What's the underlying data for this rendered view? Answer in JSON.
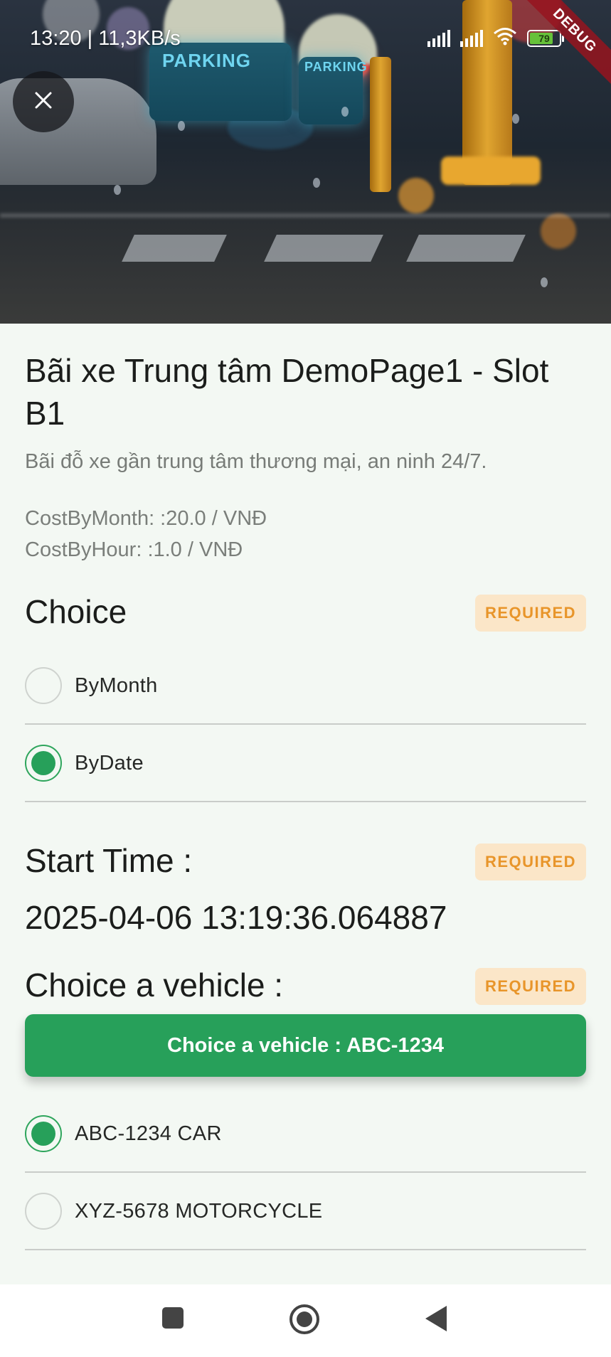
{
  "status_bar": {
    "time": "13:20 | 11,3KB/s",
    "battery_level": "79",
    "battery_fraction": 0.79
  },
  "debug_banner": "DEBUG",
  "hero": {
    "sign_texts": [
      "PARKING",
      "PARKING"
    ],
    "close_icon": "close-icon"
  },
  "lot": {
    "title": "Bãi xe Trung tâm DemoPage1    - Slot B1",
    "description": "Bãi đỗ xe gần trung tâm thương mại, an ninh 24/7.",
    "cost_by_month": "CostByMonth: :20.0 / VNĐ",
    "cost_by_hour": "CostByHour: :1.0 / VNĐ"
  },
  "choice": {
    "title": "Choice",
    "badge": "REQUIRED",
    "options": [
      {
        "label": "ByMonth",
        "selected": false
      },
      {
        "label": "ByDate",
        "selected": true
      }
    ]
  },
  "start_time": {
    "title": "Start Time  :",
    "badge": "REQUIRED",
    "value": "2025-04-06 13:19:36.064887"
  },
  "vehicle": {
    "title": "Choice a vehicle :",
    "badge": "REQUIRED",
    "button_label": "Choice a vehicle : ABC-1234",
    "options": [
      {
        "label": "ABC-1234 CAR",
        "selected": true
      },
      {
        "label": "XYZ-5678 MOTORCYCLE",
        "selected": false
      }
    ]
  },
  "colors": {
    "accent": "#27a05a",
    "badge_bg": "#fbe6c8",
    "badge_text": "#e8952a",
    "background": "#f3f8f3"
  },
  "nav": {
    "icons": [
      "recent-apps-icon",
      "home-icon",
      "back-icon"
    ]
  }
}
